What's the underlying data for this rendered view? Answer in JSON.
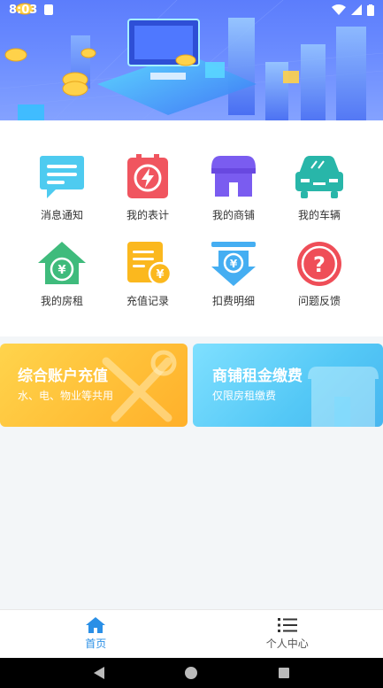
{
  "status_bar": {
    "time": "8:03"
  },
  "grid": {
    "items": [
      {
        "label": "消息通知",
        "icon": "message-icon"
      },
      {
        "label": "我的表计",
        "icon": "meter-icon"
      },
      {
        "label": "我的商铺",
        "icon": "shop-icon"
      },
      {
        "label": "我的车辆",
        "icon": "car-icon"
      },
      {
        "label": "我的房租",
        "icon": "house-rent-icon"
      },
      {
        "label": "充值记录",
        "icon": "recharge-record-icon"
      },
      {
        "label": "扣费明细",
        "icon": "deduction-detail-icon"
      },
      {
        "label": "问题反馈",
        "icon": "feedback-icon"
      }
    ]
  },
  "cards": {
    "left": {
      "title": "综合账户充值",
      "subtitle": "水、电、物业等共用"
    },
    "right": {
      "title": "商铺租金缴费",
      "subtitle": "仅限房租缴费"
    }
  },
  "bottom_nav": {
    "items": [
      {
        "label": "首页",
        "icon": "home-icon",
        "active": true
      },
      {
        "label": "个人中心",
        "icon": "list-icon",
        "active": false
      }
    ]
  },
  "colors": {
    "accent": "#2a8fe6",
    "banner": "#6b8cff",
    "card_left": "#ffc23a",
    "card_right": "#54c8f6"
  }
}
